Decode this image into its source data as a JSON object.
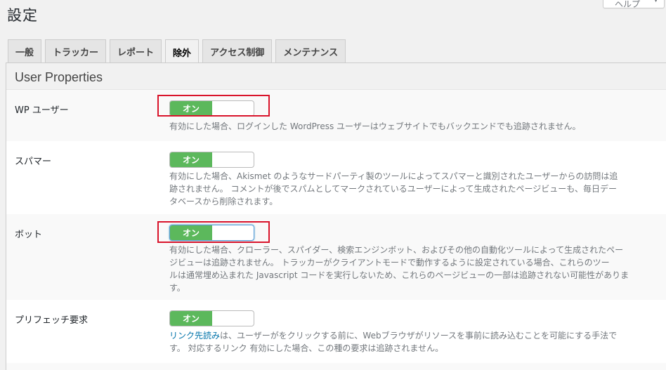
{
  "page_title": "設定",
  "help_button": {
    "label": "ヘルプ"
  },
  "tabs": [
    {
      "label": "一般",
      "active": false
    },
    {
      "label": "トラッカー",
      "active": false
    },
    {
      "label": "レポート",
      "active": false
    },
    {
      "label": "除外",
      "active": true
    },
    {
      "label": "アクセス制御",
      "active": false
    },
    {
      "label": "メンテナンス",
      "active": false
    }
  ],
  "section": {
    "title": "User Properties"
  },
  "settings": [
    {
      "label": "WP ユーザー",
      "toggle": "オン",
      "description": "有効にした場合、ログインした WordPress ユーザーはウェブサイトでもバックエンドでも追跡されません。"
    },
    {
      "label": "スパマー",
      "toggle": "オン",
      "description_lines": [
        "有効にした場合、Akismet のようなサードパーティ製のツールによってスパマーと識別されたユーザーからの訪問は追",
        "跡されません。 コメントが後でスパムとしてマークされているユーザーによって生成されたページビューも、毎日デー",
        "タベースから削除されます。"
      ]
    },
    {
      "label": "ボット",
      "toggle": "オン",
      "description_lines": [
        "有効にした場合、クローラー、スパイダー、検索エンジンボット、およびその他の自動化ツールによって生成されたペー",
        "ジビューは追跡されません。 トラッカーがクライアントモードで動作するように設定されている場合、これらのツー",
        "ルは通常埋め込まれた Javascript コードを実行しないため、これらのページビューの一部は追跡されない可能性がありま",
        "す。"
      ]
    },
    {
      "label": "プリフェッチ要求",
      "toggle": "オン",
      "link_text": "リンク先読み",
      "description_lines": [
        "は、ユーザーがをクリックする前に、Webブラウザがリソースを事前に読み込むことを可能にする手法で",
        "す。 対応するリンク 有効にした場合、この種の要求は追跡されません。"
      ]
    }
  ],
  "colors": {
    "toggle_on": "#5cb85c",
    "highlight": "#d9142b",
    "link": "#0073aa"
  }
}
